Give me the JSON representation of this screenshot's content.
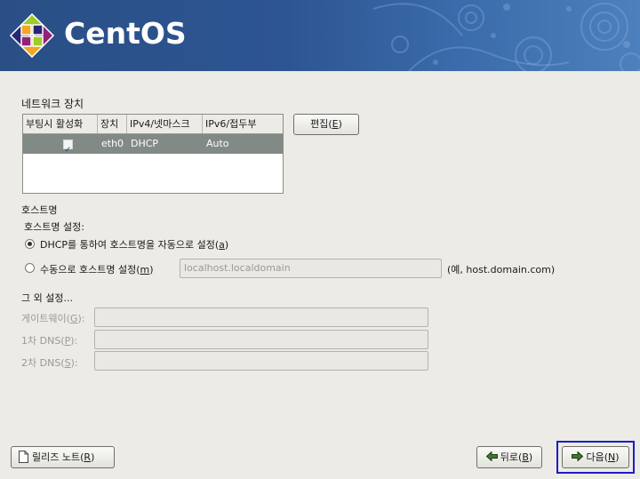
{
  "brand": {
    "name": "CentOS"
  },
  "network_devices": {
    "section_title": "네트워크 장치",
    "columns": [
      "부팅시 활성화",
      "장치",
      "IPv4/넷마스크",
      "IPv6/접두부"
    ],
    "rows": [
      {
        "active": true,
        "device": "eth0",
        "ipv4": "DHCP",
        "ipv6": "Auto"
      }
    ],
    "edit_button": {
      "label": "편집",
      "mnemonic": "E"
    }
  },
  "hostname": {
    "section_title": "호스트명",
    "setting_label": "호스트명 설정:",
    "dhcp_option": {
      "label_pre": "DHCP를 통하여 호스트명을 자동으로 설정",
      "mnemonic": "a",
      "selected": true
    },
    "manual_option": {
      "label_pre": "수동으로 호스트명 설정",
      "mnemonic": "m",
      "selected": false
    },
    "manual_value": "localhost.localdomain",
    "example": "(예, host.domain.com)"
  },
  "misc": {
    "section_title": "그 외 설정...",
    "gateway": {
      "label": "게이트웨이",
      "mnemonic": "G"
    },
    "dns1": {
      "label": "1차 DNS",
      "mnemonic": "P"
    },
    "dns2": {
      "label": "2차 DNS",
      "mnemonic": "S"
    }
  },
  "footer": {
    "release_notes": {
      "label": "릴리즈 노트",
      "mnemonic": "R",
      "icon": "document-icon"
    },
    "back": {
      "label": "뒤로",
      "mnemonic": "B",
      "icon": "arrow-left-icon"
    },
    "next": {
      "label": "다음",
      "mnemonic": "N",
      "icon": "arrow-right-icon"
    }
  },
  "colors": {
    "banner": "#2d5592",
    "selected_row": "#828a86",
    "focus_border": "#1c1cc8"
  }
}
